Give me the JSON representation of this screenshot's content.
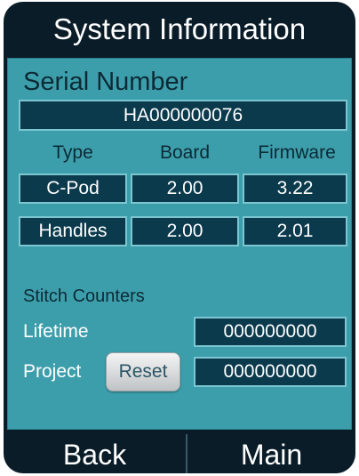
{
  "header": {
    "title": "System Information"
  },
  "serial": {
    "label": "Serial Number",
    "value": "HA000000076"
  },
  "versions": {
    "columns": [
      "Type",
      "Board",
      "Firmware"
    ],
    "rows": [
      {
        "type": "C-Pod",
        "board": "2.00",
        "firmware": "3.22"
      },
      {
        "type": "Handles",
        "board": "2.00",
        "firmware": "2.01"
      }
    ]
  },
  "stitch_counters": {
    "label": "Stitch Counters",
    "lifetime": {
      "label": "Lifetime",
      "value": "000000000"
    },
    "project": {
      "label": "Project",
      "value": "000000000",
      "reset_label": "Reset"
    }
  },
  "footer": {
    "back_label": "Back",
    "main_label": "Main"
  },
  "colors": {
    "frame": "#0a1c28",
    "panel": "#3d9eab",
    "field": "#0b3a4d",
    "field_border": "#7cc6d1"
  }
}
